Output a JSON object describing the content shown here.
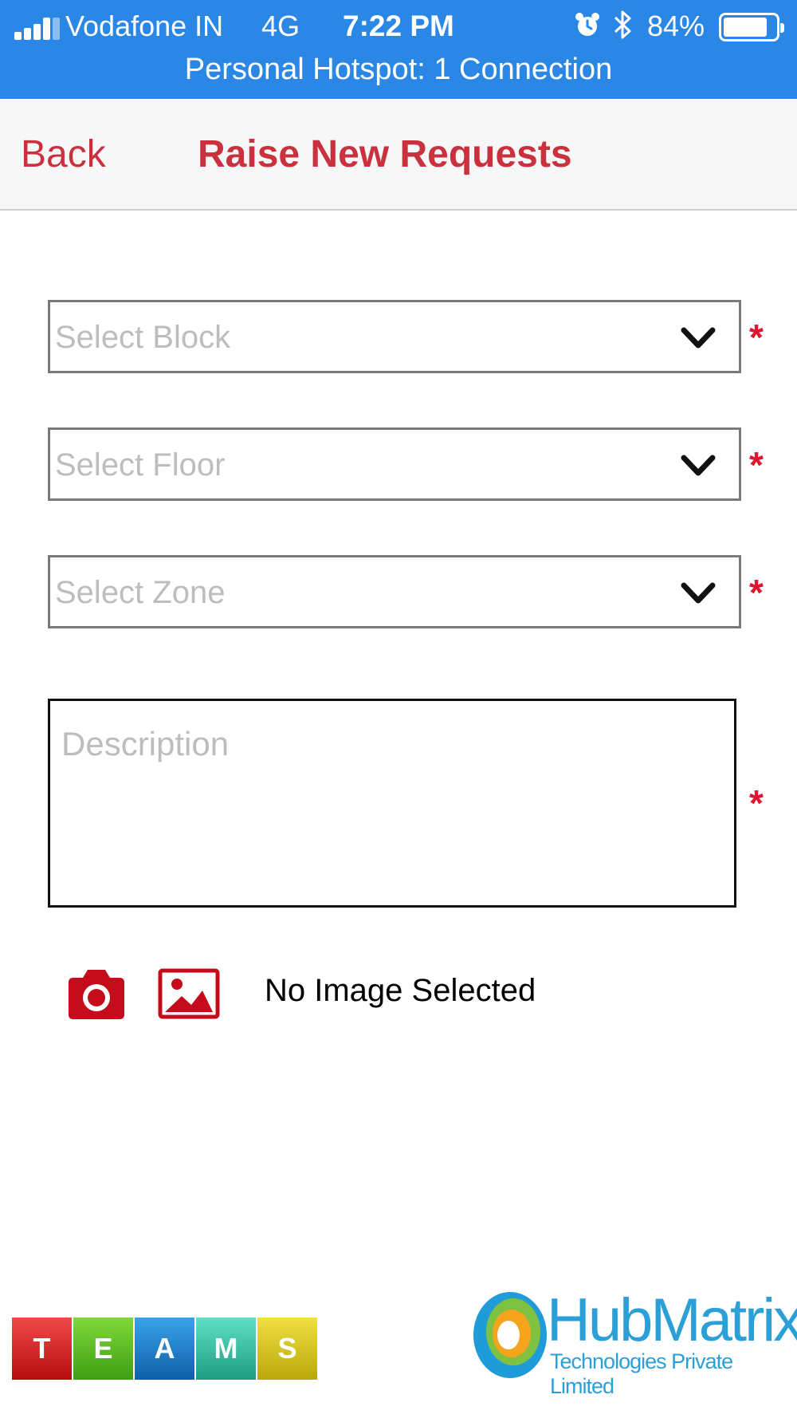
{
  "status_bar": {
    "carrier": "Vodafone IN",
    "network": "4G",
    "time": "7:22 PM",
    "battery_percent": "84%",
    "battery_level": 0.84,
    "hotspot": "Personal Hotspot: 1 Connection",
    "color": "#2a87e5"
  },
  "nav": {
    "back_label": "Back",
    "title": "Raise New Requests",
    "accent": "#c9313e"
  },
  "form": {
    "block_placeholder": "Select Block",
    "floor_placeholder": "Select Floor",
    "zone_placeholder": "Select Zone",
    "description_placeholder": "Description",
    "required_marker": "*",
    "required_color": "#e0142c"
  },
  "attachment": {
    "camera_icon": "camera-icon",
    "gallery_icon": "image-gallery-icon",
    "status": "No Image Selected",
    "icon_color": "#c40c1c"
  },
  "footer": {
    "teams_letters": [
      "T",
      "E",
      "A",
      "M",
      "S"
    ],
    "company_name": "HubMatrix",
    "company_tagline": "Technologies Private Limited"
  }
}
